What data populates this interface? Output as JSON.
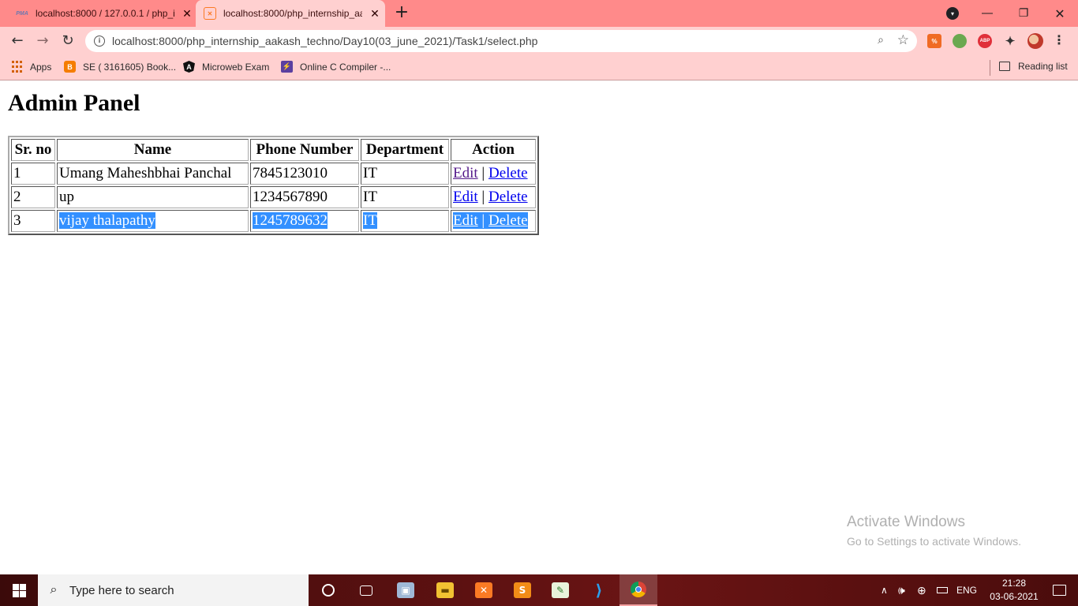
{
  "browser": {
    "tabs": [
      {
        "title": "localhost:8000 / 127.0.0.1 / php_i",
        "favicon": "phpmyadmin-icon",
        "active": false
      },
      {
        "title": "localhost:8000/php_internship_aa",
        "favicon": "xampp-icon",
        "active": true
      }
    ],
    "url": "localhost:8000/php_internship_aakash_techno/Day10(03_june_2021)/Task1/select.php",
    "bookmarks": [
      {
        "label": "Apps",
        "icon": "apps-grid-icon"
      },
      {
        "label": "SE ( 3161605) Book...",
        "icon": "blogger-icon"
      },
      {
        "label": "Microweb Exam",
        "icon": "angular-icon"
      },
      {
        "label": "Online C Compiler -...",
        "icon": "bolt-icon"
      }
    ],
    "reading_list": "Reading list",
    "extensions": {
      "e1": "%",
      "e2": "",
      "e3": "ABP"
    },
    "colors": {
      "tabstrip": "#ff8a8a",
      "toolbar": "#ffd0d0",
      "selection": "#3390ff"
    }
  },
  "page": {
    "title": "Admin Panel",
    "table": {
      "headers": [
        "Sr. no",
        "Name",
        "Phone Number",
        "Department",
        "Action"
      ],
      "rows": [
        {
          "sr": "1",
          "name": "Umang Maheshbhai Panchal",
          "phone": "7845123010",
          "dept": "IT",
          "edit": "Edit",
          "sep": "|",
          "delete": "Delete"
        },
        {
          "sr": "2",
          "name": "up",
          "phone": "1234567890",
          "dept": "IT",
          "edit": "Edit",
          "sep": "|",
          "delete": "Delete"
        },
        {
          "sr": "3",
          "name": "vijay thalapathy",
          "phone": "1245789632",
          "dept": "IT",
          "edit": "Edit",
          "sep": "|",
          "delete": "Delete"
        }
      ]
    }
  },
  "watermark": {
    "line1": "Activate Windows",
    "line2": "Go to Settings to activate Windows."
  },
  "taskbar": {
    "search_placeholder": "Type here to search",
    "language": "ENG",
    "time": "21:28",
    "date": "03-06-2021"
  }
}
